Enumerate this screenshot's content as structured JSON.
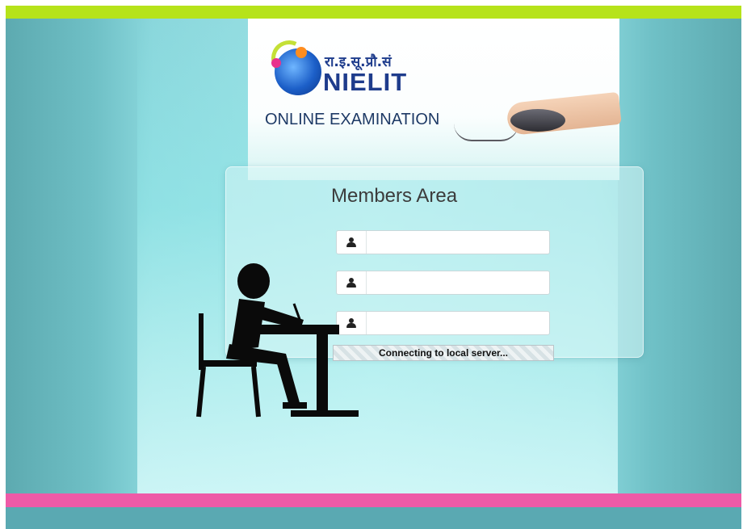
{
  "header": {
    "logo_hindi": "रा.इ.सू.प्रौ.सं",
    "logo_name": "NIELIT",
    "subtitle": "ONLINE EXAMINATION"
  },
  "login": {
    "title": "Members Area",
    "fields": [
      {
        "icon": "user-icon",
        "value": "",
        "placeholder": ""
      },
      {
        "icon": "user-icon",
        "value": "",
        "placeholder": ""
      },
      {
        "icon": "user-icon",
        "value": "",
        "placeholder": ""
      }
    ],
    "status_text": "Connecting to local server..."
  },
  "colors": {
    "top_bar": "#b6e31a",
    "bottom_bar": "#ee5aa7",
    "background": "#9fe3e6",
    "brand": "#1e3c8c"
  }
}
